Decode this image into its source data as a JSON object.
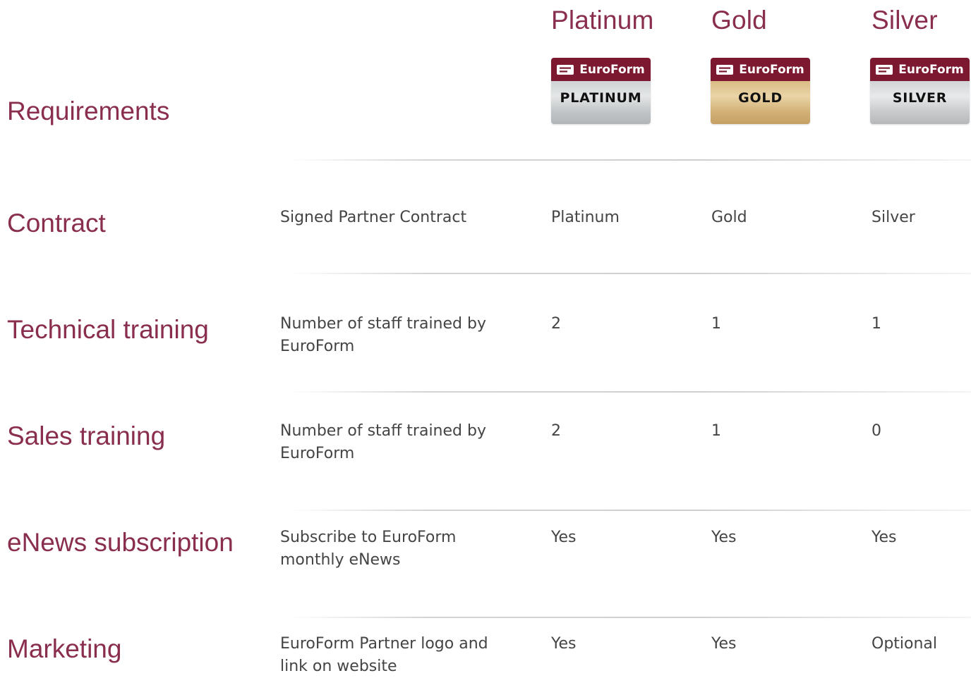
{
  "tiers": [
    {
      "name": "Platinum",
      "badge_brand": "EuroForm",
      "badge_label": "PLATINUM"
    },
    {
      "name": "Gold",
      "badge_brand": "EuroForm",
      "badge_label": "GOLD"
    },
    {
      "name": "Silver",
      "badge_brand": "EuroForm",
      "badge_label": "SILVER"
    }
  ],
  "requirements_heading": "Requirements",
  "rows": [
    {
      "heading": "Contract",
      "description": "Signed Partner Contract",
      "platinum": "Platinum",
      "gold": "Gold",
      "silver": "Silver"
    },
    {
      "heading": "Technical training",
      "description": "Number of staff trained by EuroForm",
      "platinum": "2",
      "gold": "1",
      "silver": "1"
    },
    {
      "heading": "Sales training",
      "description": "Number of staff trained by EuroForm",
      "platinum": "2",
      "gold": "1",
      "silver": "0"
    },
    {
      "heading": "eNews subscription",
      "description": "Subscribe to EuroForm monthly eNews",
      "platinum": "Yes",
      "gold": "Yes",
      "silver": "Yes"
    },
    {
      "heading": "Marketing",
      "description": "EuroForm Partner logo and link on website",
      "platinum": "Yes",
      "gold": "Yes",
      "silver": "Optional"
    }
  ],
  "colors": {
    "accent": "#8a2e4f",
    "badge_bar": "#7c1931",
    "body_text": "#444444"
  },
  "icons": {
    "badge_logo": "euroform-logo-icon"
  }
}
